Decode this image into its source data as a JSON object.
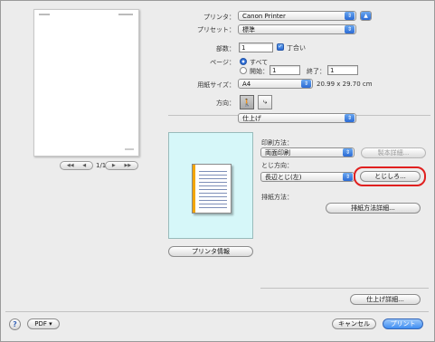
{
  "preview": {
    "page_label": "1/1",
    "first_icon": "first-page-icon",
    "prev_icon": "prev-page-icon",
    "next_icon": "next-page-icon",
    "last_icon": "last-page-icon"
  },
  "printer": {
    "label": "プリンタ：",
    "value": "Canon Printer",
    "expand_icon": "expand-triangle-icon"
  },
  "presets": {
    "label": "プリセット：",
    "value": "標準"
  },
  "copies": {
    "label": "部数：",
    "value": "1",
    "collate_label": "丁合い",
    "collate_checked": true
  },
  "pages": {
    "label": "ページ：",
    "all_label": "すべて",
    "from_label": "開始：",
    "from_value": "1",
    "to_label": "終了：",
    "to_value": "1",
    "selected": "all"
  },
  "paper_size": {
    "label": "用紙サイズ：",
    "value": "A4",
    "dimensions": "20.99 x 29.70 cm"
  },
  "orientation": {
    "label": "方向：",
    "portrait_icon": "portrait-orientation-icon",
    "landscape_icon": "landscape-orientation-icon",
    "selected": "portrait"
  },
  "panel_popup": {
    "value": "仕上げ"
  },
  "finishing": {
    "print_method_label": "印刷方法：",
    "print_method_value": "両面印刷",
    "booklet_details_button": "製本詳細...",
    "binding_dir_label": "とじ方向：",
    "binding_dir_value": "長辺とじ(左)",
    "gutter_button": "とじしろ...",
    "output_method_label": "排紙方法：",
    "output_details_button": "排紙方法詳細...",
    "finishing_details_button": "仕上げ詳細..."
  },
  "printer_info_button": "プリンタ情報",
  "bottom": {
    "help_icon": "?",
    "pdf_button": "PDF ▾",
    "cancel_button": "キャンセル",
    "print_button": "プリント"
  },
  "colors": {
    "accent": "#2a6ad4",
    "highlight": "#e0201f",
    "preview_bg": "#d6f7f9",
    "binding": "#f2a600"
  }
}
